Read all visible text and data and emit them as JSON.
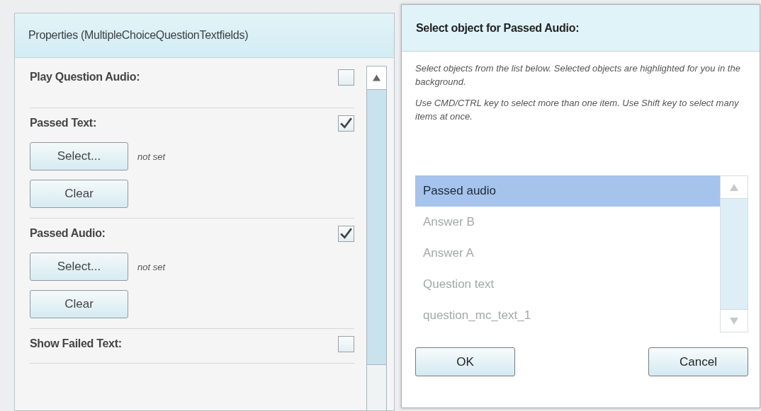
{
  "properties_panel": {
    "title": "Properties (MultipleChoiceQuestionTextfields)",
    "sections": [
      {
        "label": "Play Question Audio:",
        "checked": false
      },
      {
        "label": "Passed Text:",
        "checked": true,
        "object_value": "not set",
        "buttons": [
          "Select...",
          "Clear"
        ]
      },
      {
        "label": "Passed Audio:",
        "checked": true,
        "object_value": "not set",
        "buttons": [
          "Select...",
          "Clear"
        ]
      },
      {
        "label": "Show Failed Text:",
        "checked": false
      }
    ]
  },
  "dialog": {
    "title": "Select object for Passed Audio:",
    "instructions": [
      "Select objects from the list below. Selected objects are highlighted for you in the background.",
      "Use CMD/CTRL key to select more than one item. Use Shift key to select many items at once."
    ],
    "items": [
      {
        "label": "Passed audio",
        "selected": true
      },
      {
        "label": "Answer B",
        "selected": false
      },
      {
        "label": "Answer A",
        "selected": false
      },
      {
        "label": "Question text",
        "selected": false
      },
      {
        "label": "question_mc_text_1",
        "selected": false
      }
    ],
    "buttons": [
      "OK",
      "Cancel"
    ]
  }
}
